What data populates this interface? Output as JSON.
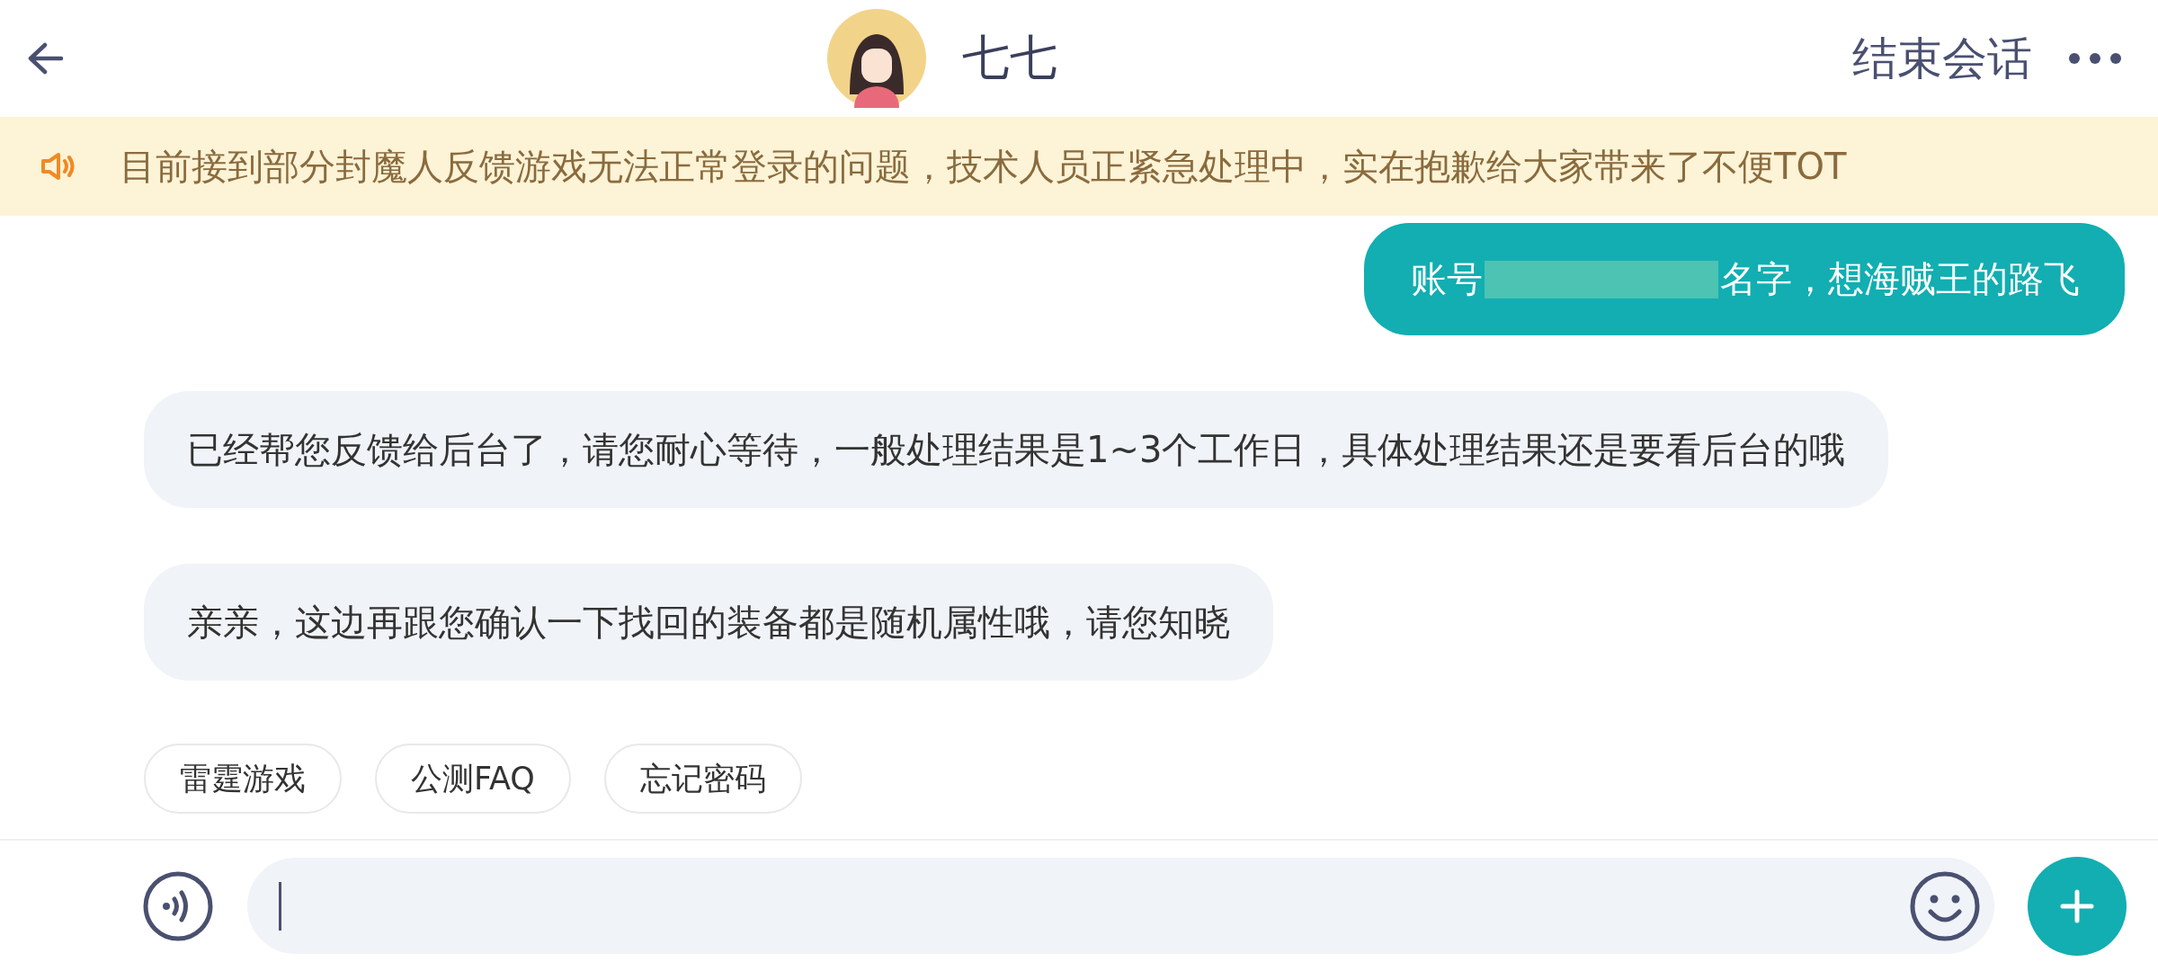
{
  "header": {
    "title": "七七",
    "end_button": "结束会话"
  },
  "notice": {
    "text": "目前接到部分封魔人反馈游戏无法正常登录的问题，技术人员正紧急处理中，实在抱歉给大家带来了不便TOT"
  },
  "messages": [
    {
      "kind": "user",
      "before": "账号",
      "redacted": true,
      "after": "名字，想海贼王的路飞"
    },
    {
      "kind": "agent",
      "text": "已经帮您反馈给后台了，请您耐心等待，一般处理结果是1~3个工作日，具体处理结果还是要看后台的哦"
    },
    {
      "kind": "agent",
      "text": "亲亲，这边再跟您确认一下找回的装备都是随机属性哦，请您知晓"
    }
  ],
  "quick_replies": [
    "雷霆游戏",
    "公测FAQ",
    "忘记密码"
  ]
}
